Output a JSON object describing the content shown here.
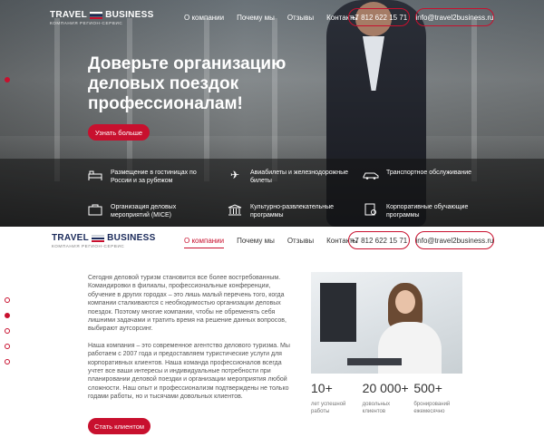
{
  "logo": {
    "word1": "TRAVEL",
    "word2": "BUSINESS",
    "sub": "КОМПАНИЯ РЕГИОН-СЕРВИС"
  },
  "nav": [
    "О компании",
    "Почему мы",
    "Отзывы",
    "Контакты"
  ],
  "phone": "+7 812 622 15 71",
  "email": "info@travel2business.ru",
  "hero": {
    "title": "Доверьте организацию деловых поездок профессионалам!",
    "cta": "Узнать больше"
  },
  "services": [
    {
      "icon": "hotel-bed-icon",
      "label": "Размещение в гостиницах по России и за рубежом"
    },
    {
      "icon": "airplane-icon",
      "label": "Авиабилеты и железнодорожные билеты"
    },
    {
      "icon": "car-icon",
      "label": "Транспортное обслуживание"
    },
    {
      "icon": "briefcase-icon",
      "label": "Организация деловых мероприятий (MICE)"
    },
    {
      "icon": "museum-icon",
      "label": "Культурно-развлекательные программы"
    },
    {
      "icon": "certificate-icon",
      "label": "Корпоративные обучающие программы"
    }
  ],
  "about": {
    "p1": "Сегодня деловой туризм становится все более востребованным. Командировки в филиалы, профессиональные конференции, обучение в других городах – это лишь малый перечень того, когда компании сталкиваются с необходимостью организации деловых поездок. Поэтому многие компании, чтобы не обременять себя лишними задачами и тратить время на решение данных вопросов, выбирают аутсорсинг.",
    "p2": "Наша компания – это современное агентство делового туризма. Мы работаем с 2007 года и предоставляем туристические услуги для корпоративных клиентов. Наша команда профессионалов всегда учтет все ваши интересы и индивидуальные потребности при планировании деловой поездки и организации мероприятия любой сложности. Наш опыт и профессионализм подтверждены не только годами работы, но и тысячами довольных клиентов.",
    "cta": "Стать клиентом"
  },
  "stats": [
    {
      "value": "10+",
      "label": "лет успешной работы"
    },
    {
      "value": "20 000+",
      "label": "довольных клиентов"
    },
    {
      "value": "500+",
      "label": "бронирований ежемесячно"
    }
  ],
  "colors": {
    "accent": "#c8102e",
    "brand_navy": "#1a2a5a"
  }
}
